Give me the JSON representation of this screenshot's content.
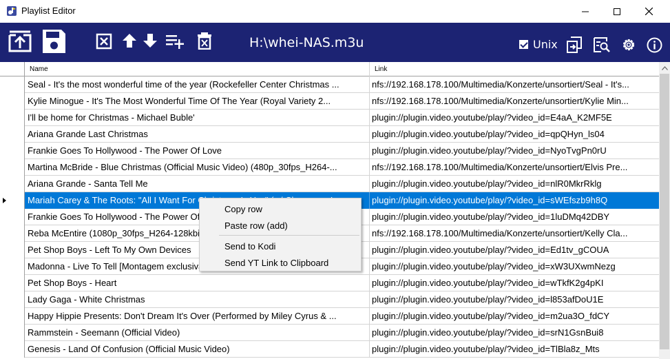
{
  "window": {
    "title": "Playlist Editor",
    "icon": "app-logo-icon"
  },
  "toolbar": {
    "filename": "H:\\whei-NAS.m3u",
    "unix_label": "Unix",
    "unix_checked": true,
    "background": "#1c2373",
    "buttons": [
      "open-icon",
      "save-icon",
      "delete-row-icon",
      "move-up-icon",
      "move-down-icon",
      "add-row-icon",
      "clear-icon",
      "export-icon",
      "find-icon",
      "settings-icon",
      "info-icon"
    ]
  },
  "grid": {
    "columns": [
      "Name",
      "Link"
    ],
    "selected_index": 7,
    "rows": [
      {
        "name": "Seal - It's the most wonderful time of the year (Rockefeller Center Christmas ...",
        "link": "nfs://192.168.178.100/Multimedia/Konzerte/unsortiert/Seal - It's..."
      },
      {
        "name": "Kylie Minogue - It's The Most Wonderful Time Of The Year (Royal Variety 2...",
        "link": "nfs://192.168.178.100/Multimedia/Konzerte/unsortiert/Kylie Min..."
      },
      {
        "name": "I'll be home for Christmas - Michael Buble'",
        "link": "plugin://plugin.video.youtube/play/?video_id=E4aA_K2MF5E"
      },
      {
        "name": "Ariana Grande Last Christmas",
        "link": "plugin://plugin.video.youtube/play/?video_id=qpQHyn_ls04"
      },
      {
        "name": "Frankie Goes To Hollywood - The Power Of Love",
        "link": "plugin://plugin.video.youtube/play/?video_id=NyoTvgPn0rU"
      },
      {
        "name": "Martina McBride - Blue Christmas (Official Music Video) (480p_30fps_H264-...",
        "link": "nfs://192.168.178.100/Multimedia/Konzerte/unsortiert/Elvis Pre..."
      },
      {
        "name": "Ariana Grande - Santa Tell Me",
        "link": "plugin://plugin.video.youtube/play/?video_id=nlR0MkrRklg"
      },
      {
        "name": "Mariah Carey & The Roots: \"All I Want For Christmas Is You\" (w/ Classroom In...",
        "link": "plugin://plugin.video.youtube/play/?video_id=sWEfszb9h8Q"
      },
      {
        "name": "Frankie Goes To Hollywood - The Power Of Love",
        "link": "plugin://plugin.video.youtube/play/?video_id=1luDMq42DBY"
      },
      {
        "name": "Reba McEntire (1080p_30fps_H264-128kbit_AAC)",
        "link": "nfs://192.168.178.100/Multimedia/Konzerte/unsortiert/Kelly Cla..."
      },
      {
        "name": "Pet Shop Boys - Left To My Own Devices",
        "link": "plugin://plugin.video.youtube/play/?video_id=Ed1tv_gCOUA"
      },
      {
        "name": "Madonna - Live To Tell [Montagem exclusiva]",
        "link": "plugin://plugin.video.youtube/play/?video_id=xW3UXwmNezg"
      },
      {
        "name": "Pet Shop Boys - Heart",
        "link": "plugin://plugin.video.youtube/play/?video_id=wTkfK2g4pKI"
      },
      {
        "name": "Lady Gaga - White Christmas",
        "link": "plugin://plugin.video.youtube/play/?video_id=l853afDoU1E"
      },
      {
        "name": "Happy Hippie Presents: Don't Dream It's Over (Performed by Miley Cyrus & ...",
        "link": "plugin://plugin.video.youtube/play/?video_id=m2ua3O_fdCY"
      },
      {
        "name": "Rammstein - Seemann (Official Video)",
        "link": "plugin://plugin.video.youtube/play/?video_id=srN1GsnBui8"
      },
      {
        "name": "Genesis - Land Of Confusion (Official Music Video)",
        "link": "plugin://plugin.video.youtube/play/?video_id=TlBla8z_Mts"
      }
    ]
  },
  "context_menu": {
    "items": [
      "Copy row",
      "Paste row (add)",
      "Send to Kodi",
      "Send YT Link to Clipboard"
    ]
  },
  "colors": {
    "selection": "#0078d7",
    "toolbar": "#1c2373"
  }
}
